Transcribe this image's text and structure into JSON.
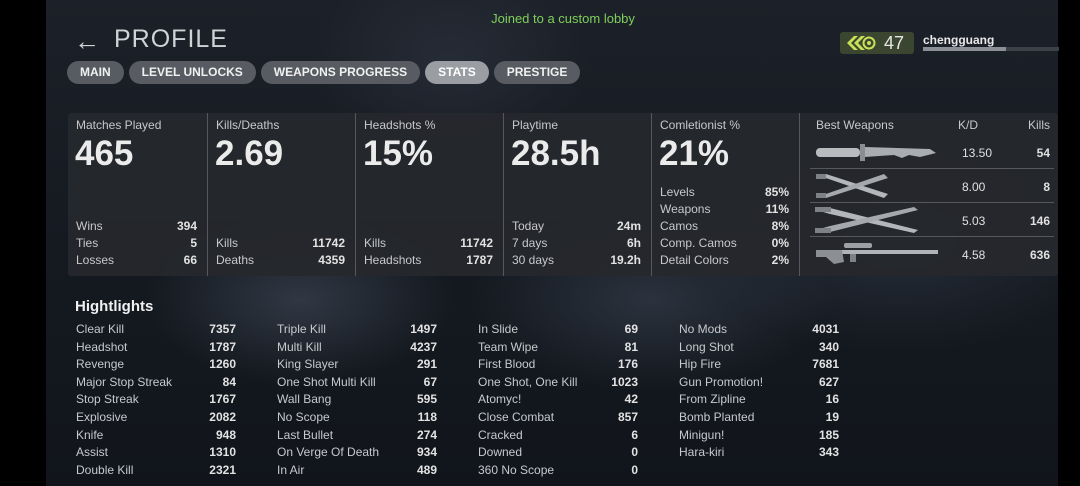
{
  "toast": "Joined to a custom lobby",
  "header": {
    "title": "PROFILE",
    "back_glyph": "←"
  },
  "tabs": [
    {
      "label": "MAIN",
      "active": false
    },
    {
      "label": "LEVEL UNLOCKS",
      "active": false
    },
    {
      "label": "WEAPONS PROGRESS",
      "active": false
    },
    {
      "label": "STATS",
      "active": true
    },
    {
      "label": "PRESTIGE",
      "active": false
    }
  ],
  "player": {
    "rank_icon": "chevron-rank-icon",
    "level": "47",
    "name": "chengguang",
    "xp_progress": 0.61
  },
  "stats": [
    {
      "label": "Matches Played",
      "value": "465",
      "rows": [
        {
          "k": "Wins",
          "v": "394"
        },
        {
          "k": "Ties",
          "v": "5"
        },
        {
          "k": "Losses",
          "v": "66"
        }
      ]
    },
    {
      "label": "Kills/Deaths",
      "value": "2.69",
      "rows": [
        {
          "k": "Kills",
          "v": "11742"
        },
        {
          "k": "Deaths",
          "v": "4359"
        }
      ]
    },
    {
      "label": "Headshots %",
      "value": "15%",
      "rows": [
        {
          "k": "Kills",
          "v": "11742"
        },
        {
          "k": "Headshots",
          "v": "1787"
        }
      ]
    },
    {
      "label": "Playtime",
      "value": "28.5h",
      "rows": [
        {
          "k": "Today",
          "v": "24m"
        },
        {
          "k": "7 days",
          "v": "6h"
        },
        {
          "k": "30 days",
          "v": "19.2h"
        }
      ]
    },
    {
      "label": "Comletionist %",
      "value": "21%",
      "rows": [
        {
          "k": "Levels",
          "v": "85%"
        },
        {
          "k": "Weapons",
          "v": "11%"
        },
        {
          "k": "Camos",
          "v": "8%"
        },
        {
          "k": "Comp. Camos",
          "v": "0%"
        },
        {
          "k": "Detail Colors",
          "v": "2%"
        }
      ]
    }
  ],
  "best_weapons": {
    "header": {
      "title": "Best Weapons",
      "kd": "K/D",
      "kills": "Kills"
    },
    "rows": [
      {
        "icon": "combat-knife-icon",
        "kd": "13.50",
        "kills": "54"
      },
      {
        "icon": "crossed-knives-icon",
        "kd": "8.00",
        "kills": "8"
      },
      {
        "icon": "crossed-machetes-icon",
        "kd": "5.03",
        "kills": "146"
      },
      {
        "icon": "sniper-rifle-icon",
        "kd": "4.58",
        "kills": "636"
      }
    ]
  },
  "highlights": {
    "title": "Hightlights",
    "columns": [
      [
        [
          "Clear Kill",
          "7357"
        ],
        [
          "Headshot",
          "1787"
        ],
        [
          "Revenge",
          "1260"
        ],
        [
          "Major Stop Streak",
          "84"
        ],
        [
          "Stop Streak",
          "1767"
        ],
        [
          "Explosive",
          "2082"
        ],
        [
          "Knife",
          "948"
        ],
        [
          "Assist",
          "1310"
        ],
        [
          "Double Kill",
          "2321"
        ]
      ],
      [
        [
          "Triple Kill",
          "1497"
        ],
        [
          "Multi Kill",
          "4237"
        ],
        [
          "King Slayer",
          "291"
        ],
        [
          "One Shot Multi Kill",
          "67"
        ],
        [
          "Wall Bang",
          "595"
        ],
        [
          "No Scope",
          "118"
        ],
        [
          "Last Bullet",
          "274"
        ],
        [
          "On Verge Of Death",
          "934"
        ],
        [
          "In Air",
          "489"
        ]
      ],
      [
        [
          "In Slide",
          "69"
        ],
        [
          "Team Wipe",
          "81"
        ],
        [
          "First Blood",
          "176"
        ],
        [
          "One Shot, One Kill",
          "1023"
        ],
        [
          "Atomyc!",
          "42"
        ],
        [
          "Close Combat",
          "857"
        ],
        [
          "Cracked",
          "6"
        ],
        [
          "Downed",
          "0"
        ],
        [
          "360 No Scope",
          "0"
        ]
      ],
      [
        [
          "No Mods",
          "4031"
        ],
        [
          "Long Shot",
          "340"
        ],
        [
          "Hip Fire",
          "7681"
        ],
        [
          "Gun Promotion!",
          "627"
        ],
        [
          "From Zipline",
          "16"
        ],
        [
          "Bomb Planted",
          "19"
        ],
        [
          "Minigun!",
          "185"
        ],
        [
          "Hara-kiri",
          "343"
        ]
      ]
    ]
  }
}
